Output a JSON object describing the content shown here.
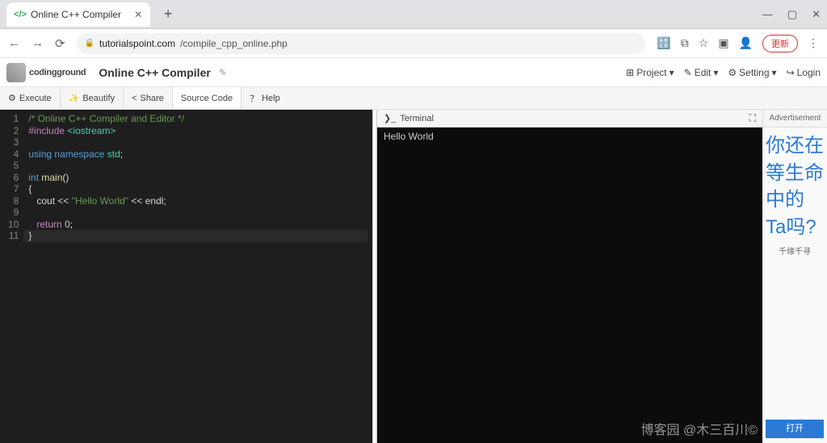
{
  "browser": {
    "tab_title": "Online C++ Compiler",
    "url_host": "tutorialspoint.com",
    "url_path": "/compile_cpp_online.php",
    "update_label": "更新"
  },
  "app": {
    "logo_text": "codingground",
    "title": "Online C++ Compiler",
    "menu": {
      "project": "Project",
      "edit": "Edit",
      "setting": "Setting",
      "login": "Login"
    }
  },
  "toolbar": {
    "execute": "Execute",
    "beautify": "Beautify",
    "share": "Share",
    "source": "Source Code",
    "help": "Help"
  },
  "code_lines": [
    {
      "n": 1,
      "html": "<span class='comment'>/* Online C++ Compiler and Editor */</span>"
    },
    {
      "n": 2,
      "html": "<span class='preproc'>#include</span> <span class='inc'>&lt;iostream&gt;</span>"
    },
    {
      "n": 3,
      "html": ""
    },
    {
      "n": 4,
      "html": "<span class='kw'>using</span> <span class='kw'>namespace</span> <span class='inc'>std</span>;"
    },
    {
      "n": 5,
      "html": ""
    },
    {
      "n": 6,
      "html": "<span class='kw'>int</span> <span class='fn'>main</span>()"
    },
    {
      "n": 7,
      "html": "{"
    },
    {
      "n": 8,
      "html": "   cout &lt;&lt; <span class='str'>\"Hello World\"</span> &lt;&lt; endl;"
    },
    {
      "n": 9,
      "html": ""
    },
    {
      "n": 10,
      "html": "   <span class='kw2'>return</span> <span class='num'>0</span>;"
    },
    {
      "n": 11,
      "html": "}"
    }
  ],
  "cursor_line": 11,
  "terminal": {
    "title": "Terminal",
    "output": "Hello World"
  },
  "ad": {
    "header": "Advertisement",
    "text": "你还在等生命中的Ta吗?",
    "small": "千缘千寻",
    "open": "打开"
  },
  "watermark": "博客园 @木三百川©"
}
